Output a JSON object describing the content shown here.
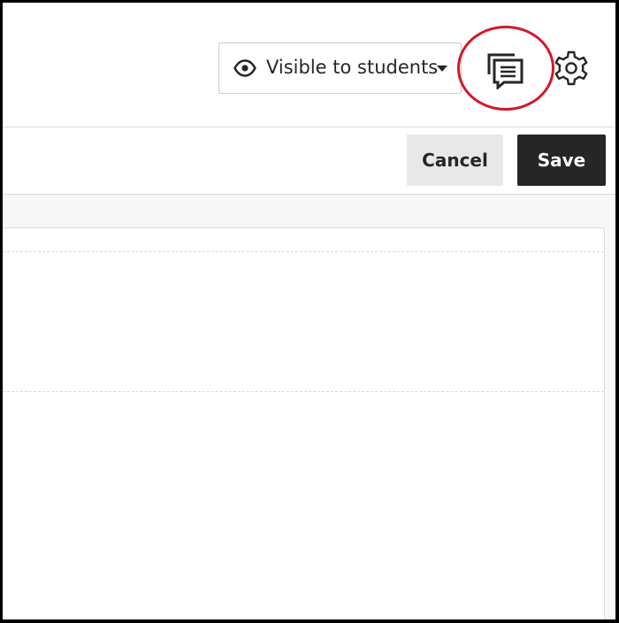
{
  "header": {
    "visibility": {
      "label": "Visible to students",
      "icon": "eye-icon",
      "dropdown_icon": "caret-down-icon"
    },
    "messages_icon": "messages-icon",
    "settings_icon": "gear-icon",
    "highlight_color": "#d11a2a"
  },
  "actions": {
    "cancel_label": "Cancel",
    "save_label": "Save",
    "save_bg": "#262626"
  }
}
